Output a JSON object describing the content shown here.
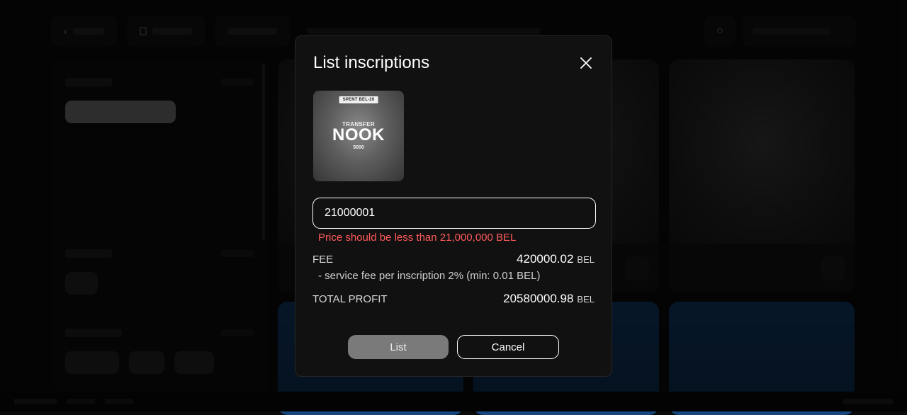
{
  "modal": {
    "title": "List inscriptions",
    "thumbnail": {
      "tag": "SPENT BEL-20",
      "operation": "TRANSFER",
      "ticker": "NOOK",
      "amount": "5000"
    },
    "price_input": {
      "value": "21000001"
    },
    "error": "Price should be less than 21,000,000 BEL",
    "fee": {
      "label": "FEE",
      "value": "420000.02",
      "currency": "BEL",
      "note": "- service fee per inscription 2% (min: 0.01 BEL)"
    },
    "total_profit": {
      "label": "TOTAL PROFIT",
      "value": "20580000.98",
      "currency": "BEL"
    },
    "buttons": {
      "list": "List",
      "cancel": "Cancel"
    }
  },
  "colors": {
    "error": "#ff5a5a",
    "modal_bg": "#111111",
    "list_button": "#7a7a7a"
  }
}
